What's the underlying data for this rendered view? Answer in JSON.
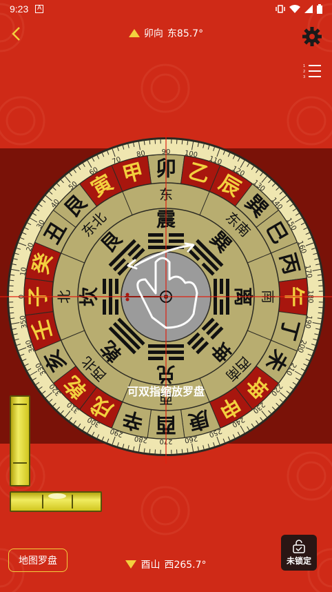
{
  "status_bar": {
    "time": "9:23",
    "icon": "A"
  },
  "header": {
    "facing_direction": "卯向",
    "facing_degrees": "东85.7°"
  },
  "compass": {
    "outer_degrees": [
      "0",
      "10",
      "20",
      "30",
      "40",
      "50",
      "60",
      "70",
      "80",
      "90",
      "100",
      "110",
      "120",
      "130",
      "140",
      "150",
      "160",
      "170",
      "180",
      "190",
      "200",
      "210",
      "220",
      "230",
      "240",
      "250",
      "260",
      "270",
      "280",
      "290",
      "300",
      "310",
      "320",
      "330",
      "340",
      "350"
    ],
    "mountains": [
      {
        "text": "卯",
        "red": false
      },
      {
        "text": "乙",
        "red": true
      },
      {
        "text": "辰",
        "red": true
      },
      {
        "text": "巽",
        "red": false
      },
      {
        "text": "巳",
        "red": false
      },
      {
        "text": "丙",
        "red": false
      },
      {
        "text": "午",
        "red": true
      },
      {
        "text": "丁",
        "red": false
      },
      {
        "text": "未",
        "red": false
      },
      {
        "text": "坤",
        "red": true
      },
      {
        "text": "申",
        "red": true
      },
      {
        "text": "庚",
        "red": false
      },
      {
        "text": "酉",
        "red": false
      },
      {
        "text": "辛",
        "red": false
      },
      {
        "text": "戌",
        "red": true
      },
      {
        "text": "乾",
        "red": true
      },
      {
        "text": "亥",
        "red": false
      },
      {
        "text": "壬",
        "red": true
      },
      {
        "text": "子",
        "red": true
      },
      {
        "text": "癸",
        "red": true
      },
      {
        "text": "丑",
        "red": false
      },
      {
        "text": "艮",
        "red": false
      },
      {
        "text": "寅",
        "red": true
      },
      {
        "text": "甲",
        "red": true
      }
    ],
    "direction_names": [
      "东",
      "东南",
      "南",
      "西南",
      "西",
      "西北",
      "北",
      "东北"
    ],
    "trigram_names": [
      "震",
      "巽",
      "离",
      "坤",
      "兑",
      "乾",
      "坎",
      "艮"
    ]
  },
  "hint_text": "可双指缩放罗盘",
  "map_button_label": "地图罗盘",
  "footer": {
    "sitting_direction": "酉山",
    "sitting_degrees": "西265.7°"
  },
  "lock_button_label": "未锁定",
  "colors": {
    "background": "#cf2a17",
    "dark_band": "#7a1208",
    "accent_yellow": "#f3d03e",
    "compass_gold": "#b8ad70",
    "compass_red": "#a8160e"
  }
}
